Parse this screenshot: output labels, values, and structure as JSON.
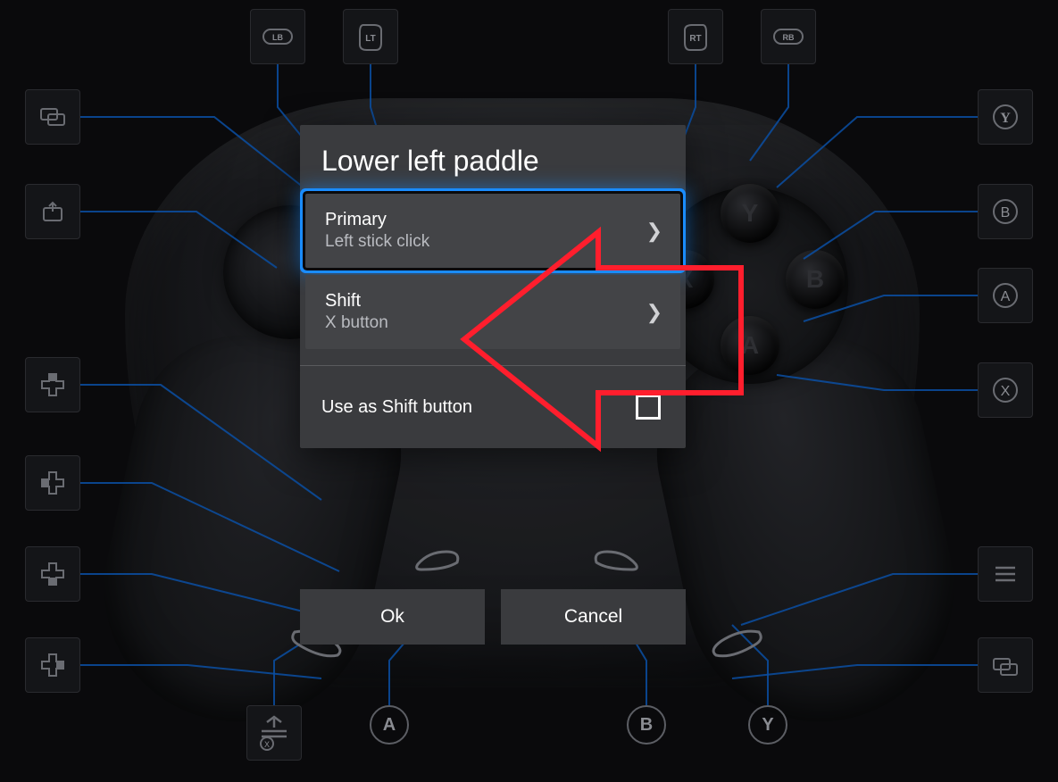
{
  "dialog": {
    "title": "Lower left paddle",
    "primary": {
      "label": "Primary",
      "value": "Left stick click"
    },
    "shift": {
      "label": "Shift",
      "value": "X button"
    },
    "use_as_shift_label": "Use as Shift button",
    "use_as_shift_checked": false,
    "ok_label": "Ok",
    "cancel_label": "Cancel",
    "focused": "primary"
  },
  "top_slots": {
    "lb": "LB",
    "lt": "LT",
    "rt": "RT",
    "rb": "RB"
  },
  "right_labels": {
    "y": "Y",
    "b": "B",
    "a": "A",
    "x": "X"
  },
  "bottom_labels_b2": "A",
  "bottom_labels_b3": "B",
  "bottom_labels_b4": "Y",
  "bottom_b1_sub": "X"
}
